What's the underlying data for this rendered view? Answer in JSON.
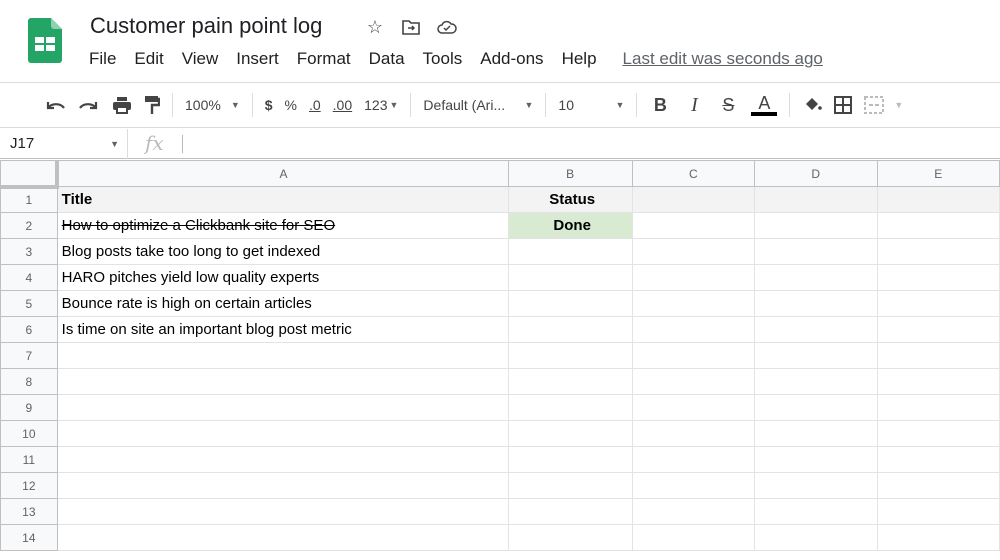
{
  "app": {
    "title": "Customer pain point log",
    "menu": [
      "File",
      "Edit",
      "View",
      "Insert",
      "Format",
      "Data",
      "Tools",
      "Add-ons",
      "Help"
    ],
    "last_edit": "Last edit was seconds ago",
    "title_icons": [
      "star-icon",
      "move-to-folder-icon",
      "cloud-saved-icon"
    ]
  },
  "toolbar": {
    "zoom": "100%",
    "currency": "$",
    "percent": "%",
    "decrease_decimal": ".0",
    "increase_decimal": ".00",
    "more_formats": "123",
    "font": "Default (Ari...",
    "font_size": "10",
    "bold": "B",
    "italic": "I",
    "strikethrough": "S",
    "text_color": "A",
    "text_color_value": "#000000"
  },
  "formula_bar": {
    "cell_ref": "J17",
    "fx": "fx",
    "value": ""
  },
  "sheet": {
    "columns": [
      "A",
      "B",
      "C",
      "D",
      "E"
    ],
    "row_numbers": [
      "1",
      "2",
      "3",
      "4",
      "5",
      "6",
      "7",
      "8",
      "9",
      "10",
      "11",
      "12",
      "13",
      "14"
    ],
    "rows": [
      {
        "a": "Title",
        "b": "Status"
      },
      {
        "a": "How to optimize a Clickbank site for SEO",
        "b": "Done"
      },
      {
        "a": "Blog posts take too long to get indexed",
        "b": ""
      },
      {
        "a": "HARO pitches yield low quality experts",
        "b": ""
      },
      {
        "a": "Bounce rate is high on certain articles",
        "b": ""
      },
      {
        "a": "Is time on site an important blog post metric",
        "b": ""
      }
    ],
    "colors": {
      "done_bg": "#d9ead3",
      "done_text": "#38761d"
    }
  }
}
